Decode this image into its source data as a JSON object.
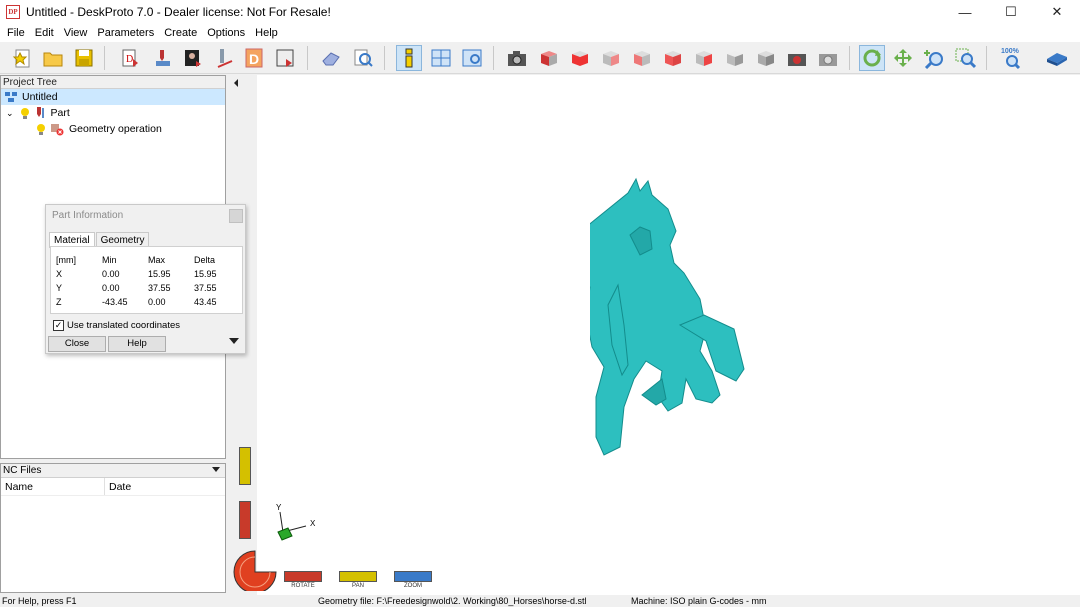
{
  "window": {
    "title": "Untitled - DeskProto 7.0 - Dealer license: Not For Resale!",
    "logo_text": "DP",
    "minimize_glyph": "—",
    "maximize_glyph": "☐",
    "close_glyph": "✕"
  },
  "menu": [
    "File",
    "Edit",
    "View",
    "Parameters",
    "Create",
    "Options",
    "Help"
  ],
  "project_tree": {
    "header": "Project Tree",
    "root": "Untitled",
    "part": "Part",
    "operation": "Geometry operation"
  },
  "nc_files": {
    "header": "NC Files",
    "columns": [
      "Name",
      "Date"
    ]
  },
  "dialog": {
    "title": "Part Information",
    "tabs": [
      "Material",
      "Geometry"
    ],
    "active_tab": "Material",
    "table": {
      "headers": [
        "[mm]",
        "Min",
        "Max",
        "Delta"
      ],
      "rows": [
        {
          "axis": "X",
          "min": "0.00",
          "max": "15.95",
          "delta": "15.95"
        },
        {
          "axis": "Y",
          "min": "0.00",
          "max": "37.55",
          "delta": "37.55"
        },
        {
          "axis": "Z",
          "min": "-43.45",
          "max": "0.00",
          "delta": "43.45"
        }
      ]
    },
    "checkbox_label": "Use translated coordinates",
    "checkbox_checked": true,
    "close_label": "Close",
    "help_label": "Help"
  },
  "viewport": {
    "axis_y": "Y",
    "axis_x": "X",
    "rotate_label": "ROTATE",
    "pan_label": "PAN",
    "zoom_label": "ZOOM",
    "zoom_tb_label": "100%",
    "model_color": "#2dbfbf"
  },
  "status": {
    "help": "For Help, press F1",
    "geometry": "Geometry file: F:\\Freedesignwold\\2. Working\\80_Horses\\horse-d.stl",
    "machine": "Machine: ISO plain G-codes - mm"
  }
}
